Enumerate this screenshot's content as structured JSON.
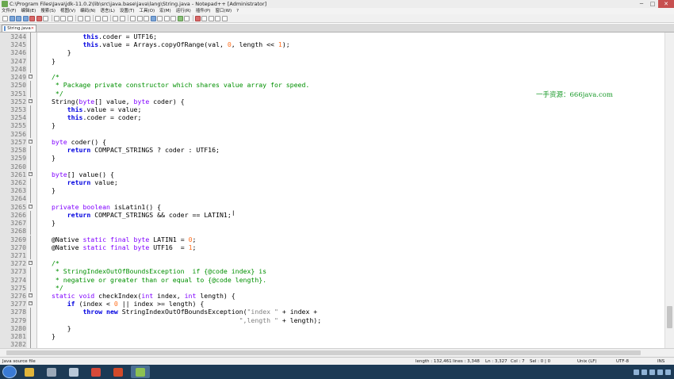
{
  "window": {
    "title": "C:\\Program Files\\Java\\jdk-11.0.2\\lib\\src\\java.base\\java\\lang\\String.java - Notepad++ [Administrator]"
  },
  "window_buttons": {
    "minimize": "─",
    "maximize": "□",
    "close": "✕"
  },
  "menu": [
    "文件(F)",
    "编辑(E)",
    "搜索(S)",
    "视图(V)",
    "编码(N)",
    "语言(L)",
    "设置(T)",
    "工具(O)",
    "宏(M)",
    "运行(R)",
    "插件(P)",
    "窗口(W)",
    "?"
  ],
  "tab": {
    "label": "String.java",
    "close": "✕"
  },
  "watermark": "一手资源：666java.com",
  "cursor_glyph": "I",
  "lines": [
    {
      "n": "3244",
      "tokens": [
        [
          "plain",
          "        "
        ],
        [
          "kw",
          "this"
        ],
        [
          "plain",
          ".coder = UTF16;"
        ]
      ]
    },
    {
      "n": "3245",
      "tokens": [
        [
          "plain",
          "        "
        ],
        [
          "kw",
          "this"
        ],
        [
          "plain",
          ".value = Arrays.copyOfRange(val, "
        ],
        [
          "num",
          "0"
        ],
        [
          "plain",
          ", length << "
        ],
        [
          "num",
          "1"
        ],
        [
          "plain",
          ");"
        ]
      ]
    },
    {
      "n": "3246",
      "tokens": [
        [
          "plain",
          "    }"
        ]
      ]
    },
    {
      "n": "3247",
      "tokens": [
        [
          "plain",
          "}"
        ]
      ]
    },
    {
      "n": "3248",
      "tokens": []
    },
    {
      "n": "3249",
      "tokens": [
        [
          "cm",
          "/*"
        ]
      ]
    },
    {
      "n": "3250",
      "tokens": [
        [
          "cm",
          " * Package private constructor which shares value array for speed."
        ]
      ]
    },
    {
      "n": "3251",
      "tokens": [
        [
          "cm",
          " */"
        ]
      ]
    },
    {
      "n": "3252",
      "tokens": [
        [
          "plain",
          "String("
        ],
        [
          "type",
          "byte"
        ],
        [
          "plain",
          "[] value, "
        ],
        [
          "type",
          "byte"
        ],
        [
          "plain",
          " coder) {"
        ]
      ]
    },
    {
      "n": "3253",
      "tokens": [
        [
          "plain",
          "    "
        ],
        [
          "kw",
          "this"
        ],
        [
          "plain",
          ".value = value;"
        ]
      ]
    },
    {
      "n": "3254",
      "tokens": [
        [
          "plain",
          "    "
        ],
        [
          "kw",
          "this"
        ],
        [
          "plain",
          ".coder = coder;"
        ]
      ]
    },
    {
      "n": "3255",
      "tokens": [
        [
          "plain",
          "}"
        ]
      ]
    },
    {
      "n": "3256",
      "tokens": []
    },
    {
      "n": "3257",
      "tokens": [
        [
          "type",
          "byte"
        ],
        [
          "plain",
          " coder() {"
        ]
      ]
    },
    {
      "n": "3258",
      "tokens": [
        [
          "plain",
          "    "
        ],
        [
          "kw",
          "return"
        ],
        [
          "plain",
          " COMPACT_STRINGS ? coder : UTF16;"
        ]
      ]
    },
    {
      "n": "3259",
      "tokens": [
        [
          "plain",
          "}"
        ]
      ]
    },
    {
      "n": "3260",
      "tokens": []
    },
    {
      "n": "3261",
      "tokens": [
        [
          "type",
          "byte"
        ],
        [
          "plain",
          "[] value() {"
        ]
      ]
    },
    {
      "n": "3262",
      "tokens": [
        [
          "plain",
          "    "
        ],
        [
          "kw",
          "return"
        ],
        [
          "plain",
          " value;"
        ]
      ]
    },
    {
      "n": "3263",
      "tokens": [
        [
          "plain",
          "}"
        ]
      ]
    },
    {
      "n": "3264",
      "tokens": []
    },
    {
      "n": "3265",
      "tokens": [
        [
          "type",
          "private"
        ],
        [
          "plain",
          " "
        ],
        [
          "type",
          "boolean"
        ],
        [
          "plain",
          " isLatin1() {"
        ]
      ]
    },
    {
      "n": "3266",
      "tokens": [
        [
          "plain",
          "    "
        ],
        [
          "kw",
          "return"
        ],
        [
          "plain",
          " COMPACT_STRINGS && coder == LATIN1;"
        ]
      ]
    },
    {
      "n": "3267",
      "tokens": [
        [
          "plain",
          "}"
        ]
      ]
    },
    {
      "n": "3268",
      "tokens": []
    },
    {
      "n": "3269",
      "tokens": [
        [
          "plain",
          "@Native "
        ],
        [
          "type",
          "static"
        ],
        [
          "plain",
          " "
        ],
        [
          "type",
          "final"
        ],
        [
          "plain",
          " "
        ],
        [
          "type",
          "byte"
        ],
        [
          "plain",
          " LATIN1 = "
        ],
        [
          "num",
          "0"
        ],
        [
          "plain",
          ";"
        ]
      ]
    },
    {
      "n": "3270",
      "tokens": [
        [
          "plain",
          "@Native "
        ],
        [
          "type",
          "static"
        ],
        [
          "plain",
          " "
        ],
        [
          "type",
          "final"
        ],
        [
          "plain",
          " "
        ],
        [
          "type",
          "byte"
        ],
        [
          "plain",
          " UTF16  = "
        ],
        [
          "num",
          "1"
        ],
        [
          "plain",
          ";"
        ]
      ]
    },
    {
      "n": "3271",
      "tokens": []
    },
    {
      "n": "3272",
      "tokens": [
        [
          "cm",
          "/*"
        ]
      ]
    },
    {
      "n": "3273",
      "tokens": [
        [
          "cm",
          " * StringIndexOutOfBoundsException  if {@code index} is"
        ]
      ]
    },
    {
      "n": "3274",
      "tokens": [
        [
          "cm",
          " * negative or greater than or equal to {@code length}."
        ]
      ]
    },
    {
      "n": "3275",
      "tokens": [
        [
          "cm",
          " */"
        ]
      ]
    },
    {
      "n": "3276",
      "tokens": [
        [
          "type",
          "static"
        ],
        [
          "plain",
          " "
        ],
        [
          "type",
          "void"
        ],
        [
          "plain",
          " checkIndex("
        ],
        [
          "type",
          "int"
        ],
        [
          "plain",
          " index, "
        ],
        [
          "type",
          "int"
        ],
        [
          "plain",
          " length) {"
        ]
      ]
    },
    {
      "n": "3277",
      "tokens": [
        [
          "plain",
          "    "
        ],
        [
          "kw",
          "if"
        ],
        [
          "plain",
          " (index < "
        ],
        [
          "num",
          "0"
        ],
        [
          "plain",
          " || index >= length) {"
        ]
      ]
    },
    {
      "n": "3278",
      "tokens": [
        [
          "plain",
          "        "
        ],
        [
          "kw",
          "throw"
        ],
        [
          "plain",
          " "
        ],
        [
          "kw",
          "new"
        ],
        [
          "plain",
          " StringIndexOutOfBoundsException("
        ],
        [
          "str",
          "\"index \""
        ],
        [
          "plain",
          " + index +"
        ]
      ]
    },
    {
      "n": "3279",
      "tokens": [
        [
          "plain",
          "                                                "
        ],
        [
          "str",
          "\",length \""
        ],
        [
          "plain",
          " + length);"
        ]
      ]
    },
    {
      "n": "3280",
      "tokens": [
        [
          "plain",
          "    }"
        ]
      ]
    },
    {
      "n": "3281",
      "tokens": [
        [
          "plain",
          "}"
        ]
      ]
    },
    {
      "n": "3282",
      "tokens": []
    }
  ],
  "folds": {
    "3249": "minus",
    "3252": "minus",
    "3257": "minus",
    "3261": "minus",
    "3265": "minus",
    "3272": "minus",
    "3276": "minus",
    "3277": "minus"
  },
  "status": {
    "file_type": "Java source file",
    "length": "length : 132,461",
    "lines": "lines : 3,348",
    "ln": "Ln : 3,327",
    "col": "Col : 7",
    "sel": "Sel : 0 | 0",
    "eol": "Unix (LF)",
    "encoding": "UTF-8",
    "ins": "INS"
  },
  "taskbar": {
    "apps": [
      "explorer",
      "settings",
      "file",
      "chrome",
      "powerpoint",
      "notepadpp"
    ],
    "app_colors": [
      "#e0b43a",
      "#9aa9b8",
      "#b8c8d8",
      "#d64a3a",
      "#d24a2a",
      "#8cc152"
    ]
  }
}
